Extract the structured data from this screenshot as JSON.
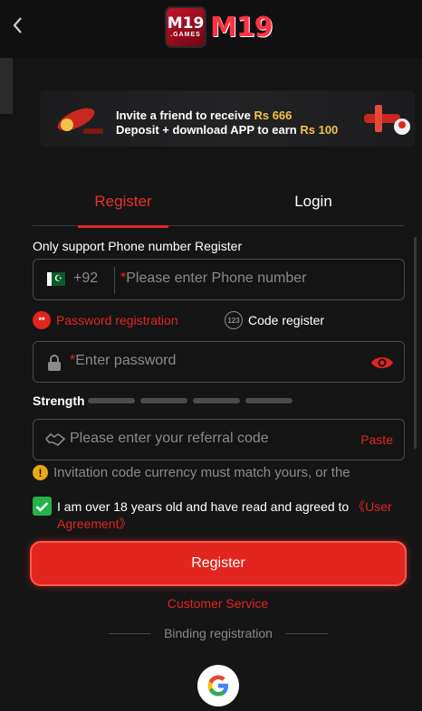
{
  "header": {
    "back_label": "back",
    "logo_badge_text": "M19",
    "logo_badge_sub": ".GAMES",
    "logo_text": "M19"
  },
  "banner": {
    "line1_prefix": "Invite a friend to receive",
    "line1_amount": "Rs 666",
    "line2_prefix": "Deposit + download APP to earn",
    "line2_amount": "Rs 100"
  },
  "tabs": {
    "register": "Register",
    "login": "Login",
    "active": "register"
  },
  "form": {
    "support_label": "Only support Phone number Register",
    "phone": {
      "country_code": "+92",
      "required_mark": "*",
      "placeholder": "Please enter Phone number",
      "flag": "pakistan-flag-icon"
    },
    "modes": {
      "password_badge": "**",
      "password": "Password registration",
      "code_badge": "123",
      "code": "Code register"
    },
    "password": {
      "required_mark": "*",
      "placeholder": "Enter password"
    },
    "strength": {
      "label": "Strength",
      "bars_filled": 0,
      "bars_total": 4
    },
    "referral": {
      "placeholder": "Please enter your referral code",
      "paste": "Paste"
    },
    "info_text": "Invitation code currency must match yours, or the",
    "agreement": {
      "checked": true,
      "text": "I am over 18 years old and have read and agreed to ",
      "link": "《User Agreement》"
    },
    "register_button": "Register"
  },
  "footer": {
    "customer_service": "Customer Service",
    "binding": "Binding registration",
    "google": "google-icon"
  },
  "colors": {
    "accent": "#e1261f",
    "background": "#141415",
    "check": "#24b24a",
    "gold": "#f2c24b"
  }
}
